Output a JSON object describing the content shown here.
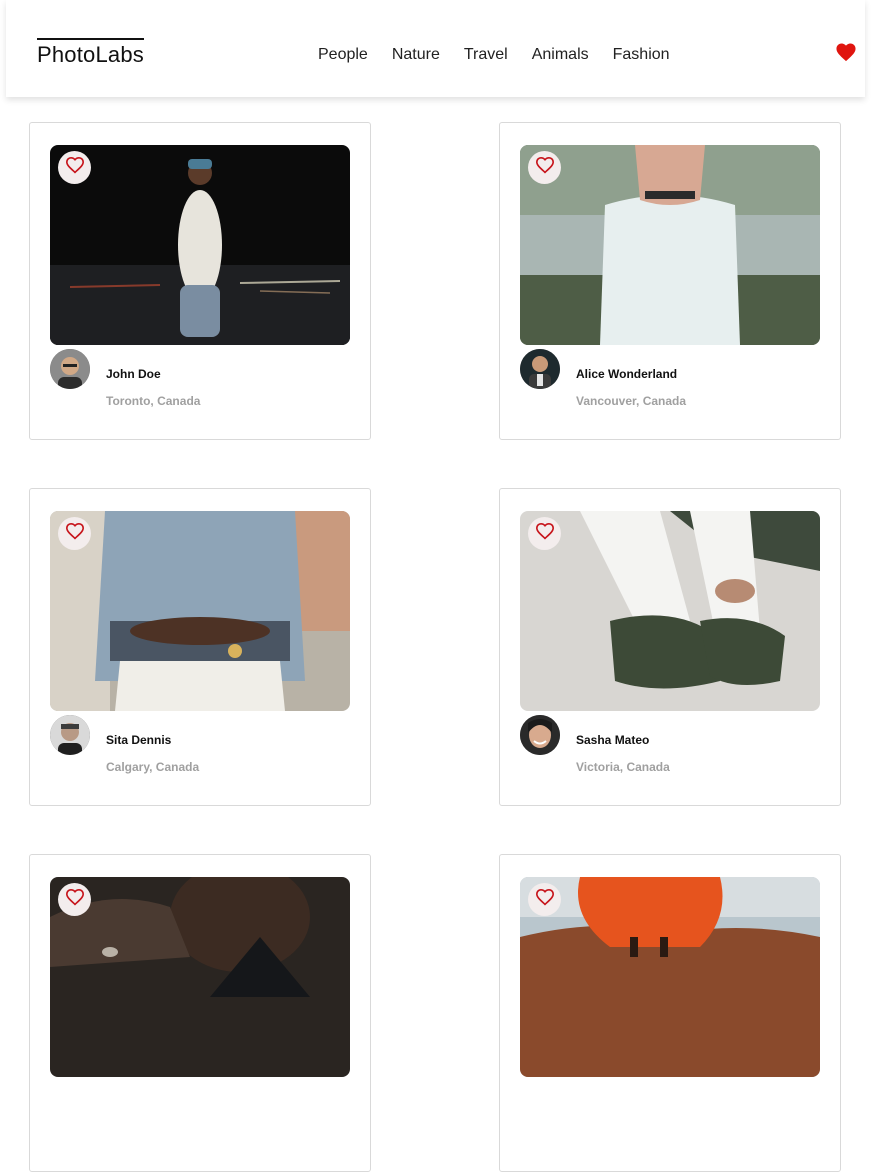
{
  "brand": {
    "logo_text": "PhotoLabs"
  },
  "nav": {
    "items": [
      "People",
      "Nature",
      "Travel",
      "Animals",
      "Fashion"
    ]
  },
  "icons": {
    "favorites": "heart-filled-icon",
    "like": "heart-outline-icon",
    "heart_color": "#e0150f",
    "heart_outline_color": "#c7141b"
  },
  "photos": [
    {
      "name": "John Doe",
      "location": "Toronto, Canada",
      "liked": false
    },
    {
      "name": "Alice Wonderland",
      "location": "Vancouver, Canada",
      "liked": false
    },
    {
      "name": "Sita Dennis",
      "location": "Calgary, Canada",
      "liked": false
    },
    {
      "name": "Sasha Mateo",
      "location": "Victoria, Canada",
      "liked": false
    },
    {
      "name": "",
      "location": "",
      "liked": false
    },
    {
      "name": "",
      "location": "",
      "liked": false
    }
  ]
}
